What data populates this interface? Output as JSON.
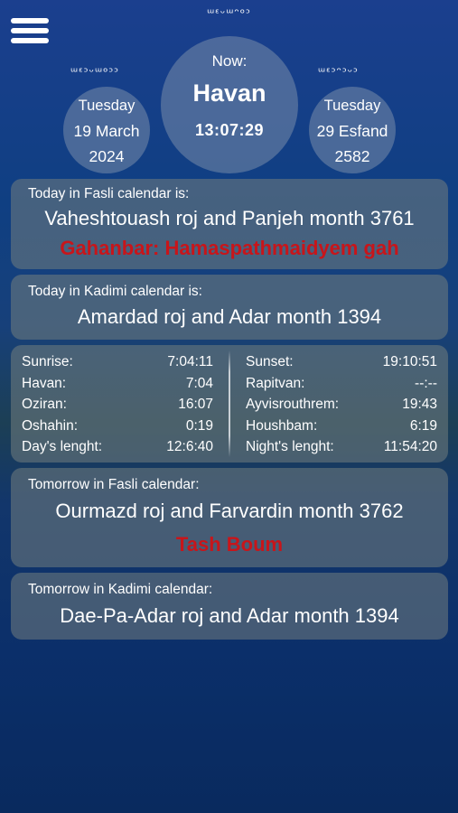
{
  "header": {
    "script_top": "ᵚᵋᵕᵚᵔᵒᵓ",
    "script_left": "ᵚᵋᵓᵕᵚᵒᵓᵓ",
    "script_right": "ᵚᵋᵓᵔᵓᵕᵓ"
  },
  "gregorian": {
    "day": "Tuesday",
    "date": "19 March",
    "year": "2024"
  },
  "now": {
    "label": "Now:",
    "gah": "Havan",
    "time": "13:07:29"
  },
  "yazdegerdi": {
    "day": "Tuesday",
    "date": "29 Esfand",
    "year": "2582"
  },
  "today_fasli": {
    "caption": "Today in Fasli calendar is:",
    "text": "Vaheshtouash roj and Panjeh month 3761",
    "event": "Gahanbar: Hamaspathmaidyem gah"
  },
  "today_kadimi": {
    "caption": "Today in Kadimi calendar is:",
    "text": "Amardad roj and Adar  month 1394"
  },
  "times": {
    "left": [
      {
        "label": "Sunrise:",
        "value": "7:04:11"
      },
      {
        "label": "Havan:",
        "value": "7:04"
      },
      {
        "label": "Oziran:",
        "value": "16:07"
      },
      {
        "label": "Oshahin:",
        "value": "0:19"
      },
      {
        "label": "Day's lenght:",
        "value": "12:6:40"
      }
    ],
    "right": [
      {
        "label": "Sunset:",
        "value": "19:10:51"
      },
      {
        "label": "Rapitvan:",
        "value": "--:--"
      },
      {
        "label": "Ayvisrouthrem:",
        "value": "19:43"
      },
      {
        "label": "Houshbam:",
        "value": "6:19"
      },
      {
        "label": "Night's lenght:",
        "value": "11:54:20"
      }
    ]
  },
  "tomorrow_fasli": {
    "caption": "Tomorrow in Fasli calendar:",
    "text": "Ourmazd roj and Farvardin month 3762",
    "event": "Tash Boum"
  },
  "tomorrow_kadimi": {
    "caption": "Tomorrow  in Kadimi calendar:",
    "text": "Dae-Pa-Adar roj and Adar  month 1394"
  },
  "colors": {
    "event_red": "#c8151a",
    "card_bg": "rgba(115,125,125,0.55)"
  }
}
